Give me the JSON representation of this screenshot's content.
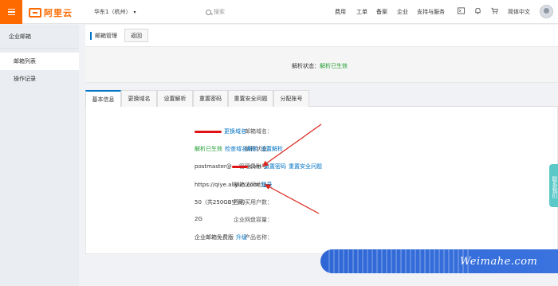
{
  "topbar": {
    "logo_text": "阿里云",
    "region": "华东1（杭州）",
    "search_placeholder": "搜索",
    "nav": [
      "费用",
      "工单",
      "备案",
      "企业",
      "支持与服务"
    ],
    "language": "简体中文",
    "brand_color": "#ff6a00"
  },
  "sidebar": {
    "header": "企业邮箱",
    "items": [
      {
        "label": "邮箱列表",
        "active": true
      },
      {
        "label": "操作记录",
        "active": false
      }
    ]
  },
  "breadcrumb": {
    "title": "邮箱管理",
    "back_label": "返回"
  },
  "status": {
    "label": "解析状态：",
    "value": "解析已生效"
  },
  "tabs": [
    {
      "label": "基本信息",
      "active": true
    },
    {
      "label": "更换域名",
      "active": false
    },
    {
      "label": "设置解析",
      "active": false
    },
    {
      "label": "重置密码",
      "active": false
    },
    {
      "label": "重置安全问题",
      "active": false
    },
    {
      "label": "分配账号",
      "active": false
    }
  ],
  "details": {
    "domain": {
      "label": "邮箱域名：",
      "link": "更换域名"
    },
    "dns": {
      "label": "解析状态：",
      "status": "解析已生效",
      "links": [
        "检查域名解析",
        "设置解析"
      ]
    },
    "admin": {
      "label": "管理员账号：",
      "value_prefix": "postmaster@",
      "value_suffix": ".com",
      "links": [
        "重置密码",
        "重置安全问题"
      ]
    },
    "url": {
      "label": "邮箱访问地址：",
      "value": "https://qiye.aliyun.com",
      "link": "登录"
    },
    "users": {
      "label": "已购买用户数：",
      "value": "50（共250GB空间）"
    },
    "netdisk": {
      "label": "企业网盘容量：",
      "value": "2G"
    },
    "product": {
      "label": "产品名称：",
      "value": "企业邮箱免费版",
      "link": "升级"
    }
  },
  "feedback": {
    "label": "联系我们"
  },
  "watermark": {
    "text": "Weimahe.com"
  },
  "colors": {
    "link": "#0073c6",
    "success": "#1f9e2f",
    "annotation": "#d9261c"
  }
}
